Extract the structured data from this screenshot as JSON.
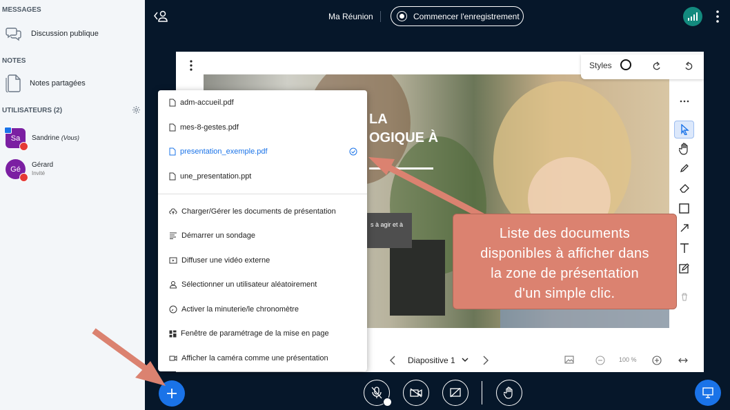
{
  "sidebar": {
    "messages_header": "MESSAGES",
    "public_chat": "Discussion publique",
    "notes_header": "NOTES",
    "shared_notes": "Notes partagées",
    "users_header": "UTILISATEURS (2)",
    "users": [
      {
        "initials": "Sa",
        "name": "Sandrine",
        "suffix": "(Vous)",
        "role": "",
        "color": "#7b1fa2"
      },
      {
        "initials": "Gé",
        "name": "Gérard",
        "suffix": "",
        "role": "Invité",
        "color": "#7b1fa2"
      }
    ]
  },
  "header": {
    "meeting_title": "Ma Réunion",
    "record_label": "Commencer l'enregistrement",
    "connection_color": "#138a7e"
  },
  "presentation": {
    "styles_label": "Styles",
    "slide_text": [
      "LA",
      "OGIQUE À"
    ],
    "slide_small": "s à agir et à",
    "slide_label": "Diapositive 1",
    "zoom": "100 %"
  },
  "menu": {
    "documents": [
      {
        "label": "adm-accueil.pdf",
        "active": false
      },
      {
        "label": "mes-8-gestes.pdf",
        "active": false
      },
      {
        "label": "presentation_exemple.pdf",
        "active": true
      },
      {
        "label": "une_presentation.ppt",
        "active": false
      }
    ],
    "actions": [
      {
        "label": "Charger/Gérer les documents de présentation",
        "icon": "upload-icon"
      },
      {
        "label": "Démarrer un sondage",
        "icon": "poll-icon"
      },
      {
        "label": "Diffuser une vidéo externe",
        "icon": "video-icon"
      },
      {
        "label": "Sélectionner un utilisateur aléatoirement",
        "icon": "user-icon"
      },
      {
        "label": "Activer la minuterie/le chronomètre",
        "icon": "timer-icon"
      },
      {
        "label": "Fenêtre de paramétrage de la mise en page",
        "icon": "layout-icon"
      },
      {
        "label": "Afficher la caméra comme une présentation",
        "icon": "camera-icon"
      }
    ]
  },
  "callout": {
    "lines": [
      "Liste des documents",
      "disponibles à afficher dans",
      "la zone de présentation",
      "d'un simple clic."
    ],
    "color": "#db8270"
  },
  "colors": {
    "accent": "#1a73e8",
    "background": "#06172a"
  }
}
